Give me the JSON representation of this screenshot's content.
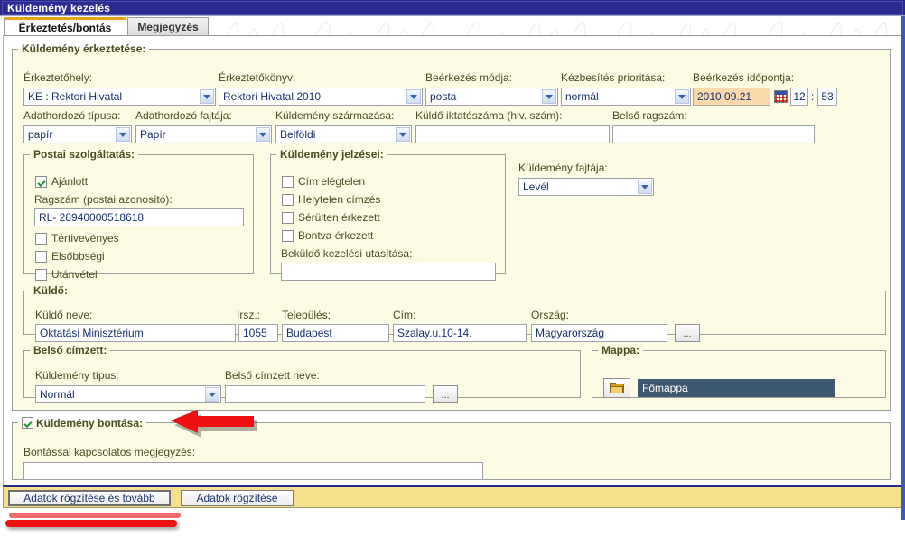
{
  "window": {
    "title": "Küldemény kezelés"
  },
  "tabs": [
    {
      "label": "Érkeztetés/bontás",
      "active": true
    },
    {
      "label": "Megjegyzés",
      "active": false
    }
  ],
  "arrival_section": {
    "legend": "Küldemény érkeztetése:",
    "fields": {
      "place_label": "Érkeztetőhely:",
      "place_value": "KE : Rektori Hivatal",
      "book_label": "Érkeztetőkönyv:",
      "book_value": "Rektori Hivatal 2010",
      "mode_label": "Beérkezés módja:",
      "mode_value": "posta",
      "priority_label": "Kézbesítés prioritása:",
      "priority_value": "normál",
      "datetime_label": "Beérkezés időpontja:",
      "date_value": "2010.09.21",
      "time_hour": "12",
      "time_sep": ":",
      "time_minute": "53",
      "media_type_label": "Adathordozó típusa:",
      "media_type_value": "papír",
      "media_kind_label": "Adathordozó fajtája:",
      "media_kind_value": "Papír",
      "origin_label": "Küldemény származása:",
      "origin_value": "Belföldi",
      "sender_regnum_label": "Küldő iktatószáma (hiv. szám):",
      "sender_regnum_value": "",
      "internal_tracking_label": "Belső ragszám:",
      "internal_tracking_value": ""
    },
    "postal": {
      "legend": "Postai szolgáltatás:",
      "registered_label": "Ajánlott",
      "registered_checked": true,
      "tracking_label": "Ragszám (postai azonosító):",
      "tracking_value": "RL- 28940000518618",
      "return_receipt_label": "Tértivevényes",
      "return_receipt_checked": false,
      "priority_mail_label": "Elsőbbségi",
      "priority_mail_checked": false,
      "cod_label": "Utánvétel",
      "cod_checked": false
    },
    "marks": {
      "legend": "Küldemény jelzései:",
      "items": [
        {
          "label": "Cím elégtelen",
          "checked": false
        },
        {
          "label": "Helytelen címzés",
          "checked": false
        },
        {
          "label": "Sérülten érkezett",
          "checked": false
        },
        {
          "label": "Bontva érkezett",
          "checked": false
        }
      ],
      "instruction_label": "Beküldő kezelési utasítása:",
      "instruction_value": ""
    },
    "kind": {
      "label": "Küldemény fajtája:",
      "value": "Levél"
    }
  },
  "sender_section": {
    "legend": "Küldő:",
    "name_label": "Küldő neve:",
    "name_value": "Oktatási Minisztérium",
    "zip_label": "Irsz.:",
    "zip_value": "1055",
    "city_label": "Település:",
    "city_value": "Budapest",
    "address_label": "Cím:",
    "address_value": "Szalay.u.10-14.",
    "country_label": "Ország:",
    "country_value": "Magyarország",
    "browse_label": "..."
  },
  "internal_section": {
    "legend": "Belső címzett:",
    "type_label": "Küldemény típus:",
    "type_value": "Normál",
    "name_label": "Belső címzett neve:",
    "name_value": "",
    "browse_label": "..."
  },
  "folder_section": {
    "legend": "Mappa:",
    "folder_icon": "folder-icon",
    "selected_folder": "Főmappa"
  },
  "opening_section": {
    "legend_checkbox_label": "Küldemény bontása:",
    "legend_checked": true,
    "note_label": "Bontással kapcsolatos megjegyzés:",
    "note_value": ""
  },
  "buttons": {
    "save_and_next": "Adatok rögzítése és tovább",
    "save": "Adatok rögzítése"
  },
  "annotations": {
    "arrow": "red-left-arrow",
    "underline": "red-underline-bar"
  },
  "colors": {
    "titlebar": "#2b2b91",
    "tab_active_top": "#e8a317",
    "fieldset_bg": "#fcfce4",
    "legend_text": "#4b4b22",
    "input_text": "#17306b",
    "date_bg": "#fbd9ab",
    "folder_selected_bg": "#3f5871",
    "button_bar_bg": "#f7e08a",
    "annotation_red": "#ee1111"
  }
}
